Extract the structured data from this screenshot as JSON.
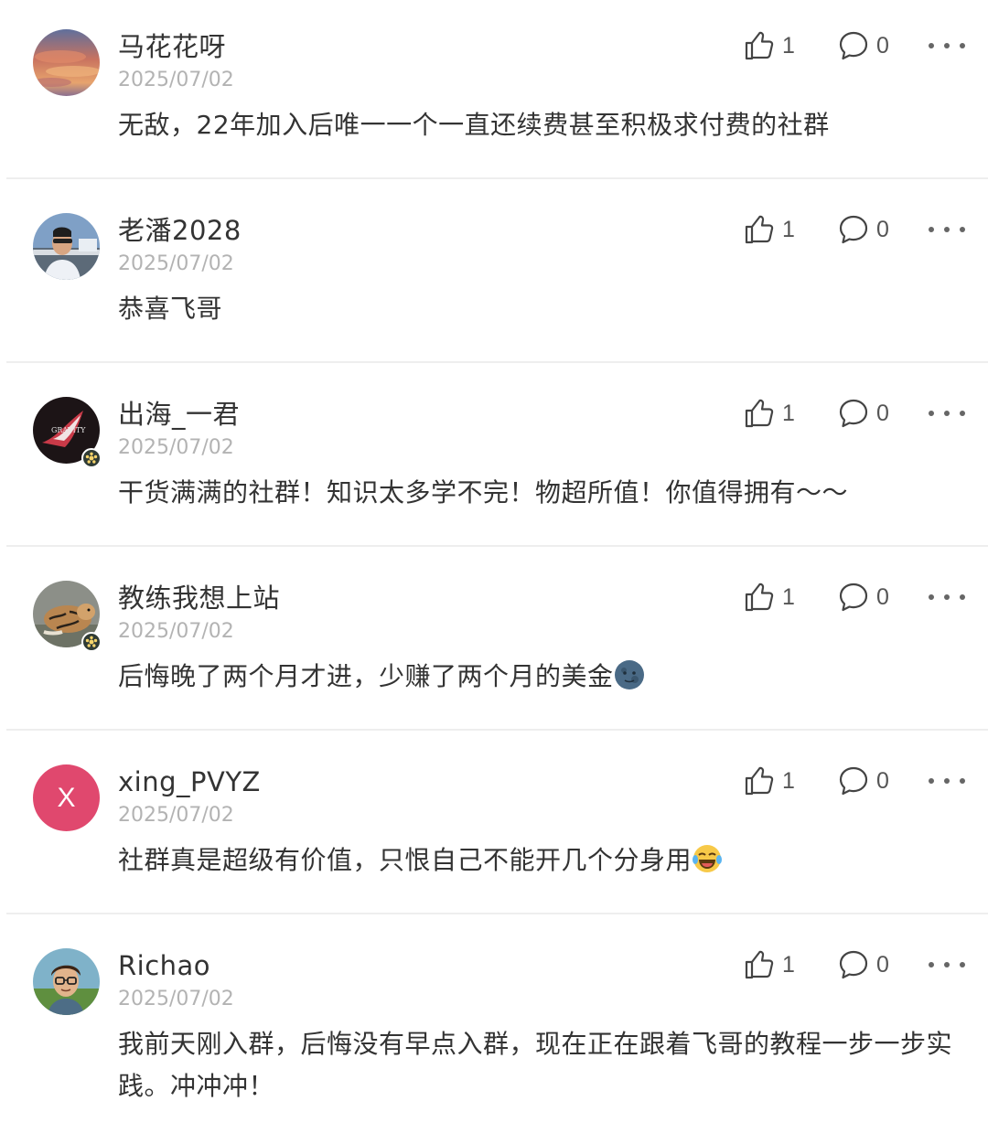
{
  "comments": [
    {
      "name": "马花花呀",
      "date": "2025/07/02",
      "text": "无敌，22年加入后唯一一个一直还续费甚至积极求付费的社群",
      "likes": "1",
      "replies": "0",
      "avatar": "sunset-sky"
    },
    {
      "name": "老潘2028",
      "date": "2025/07/02",
      "text": "恭喜飞哥",
      "likes": "1",
      "replies": "0",
      "avatar": "man-photo"
    },
    {
      "name": "出海_一君",
      "date": "2025/07/02",
      "text": "干货满满的社群！知识太多学不完！物超所值！你值得拥有～～",
      "likes": "1",
      "replies": "0",
      "avatar": "gravity-art",
      "avatar_text": "GRAVITY",
      "badge": true
    },
    {
      "name": "教练我想上站",
      "date": "2025/07/02",
      "text": "后悔晚了两个月才进，少赚了两个月的美金",
      "emoji": "new-moon-face",
      "likes": "1",
      "replies": "0",
      "avatar": "tiger-photo",
      "badge": true
    },
    {
      "name": "xing_PVYZ",
      "date": "2025/07/02",
      "text": "社群真是超级有价值，只恨自己不能开几个分身用",
      "emoji": "tears-of-joy",
      "likes": "1",
      "replies": "0",
      "avatar": "letter",
      "avatar_letter": "X",
      "avatar_color": "#e0486e"
    },
    {
      "name": "Richao",
      "date": "2025/07/02",
      "text": "我前天刚入群，后悔没有早点入群，现在正在跟着飞哥的教程一步一步实践。冲冲冲！",
      "likes": "1",
      "replies": "0",
      "avatar": "cartoon-man"
    }
  ],
  "icons": {
    "like": "thumbs-up-icon",
    "reply": "speech-bubble-icon",
    "more": "more-dots-icon"
  }
}
